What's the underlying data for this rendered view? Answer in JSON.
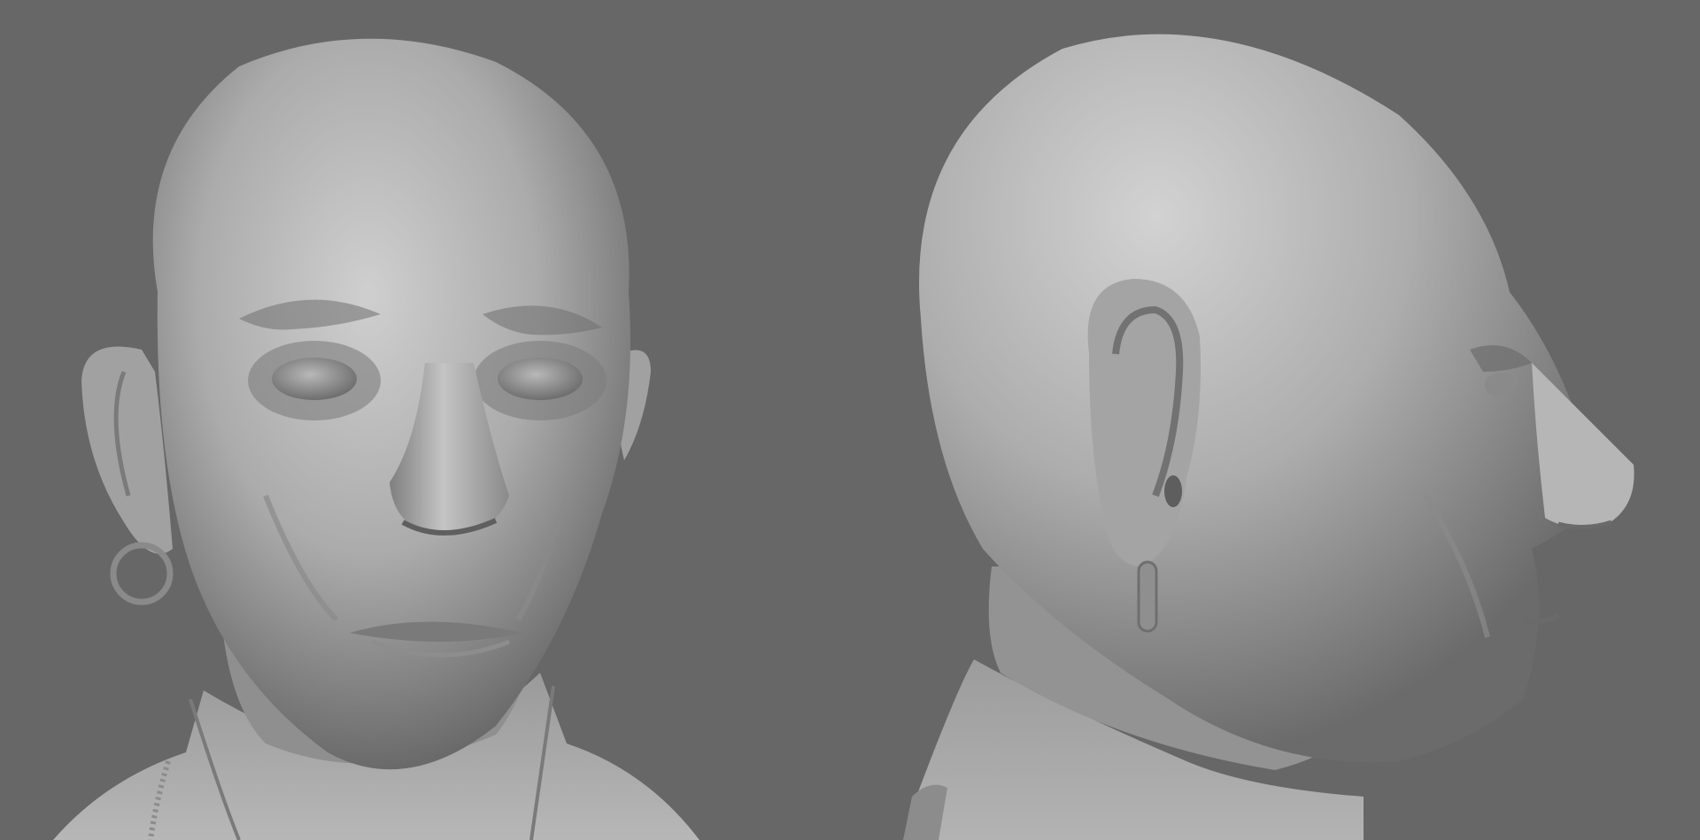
{
  "scene": {
    "background_color": "#676767",
    "material_color": "#a9a9a9",
    "views": [
      {
        "name": "front",
        "subject": "bald-male-head-sculpt"
      },
      {
        "name": "side",
        "subject": "bald-male-head-sculpt"
      }
    ]
  }
}
